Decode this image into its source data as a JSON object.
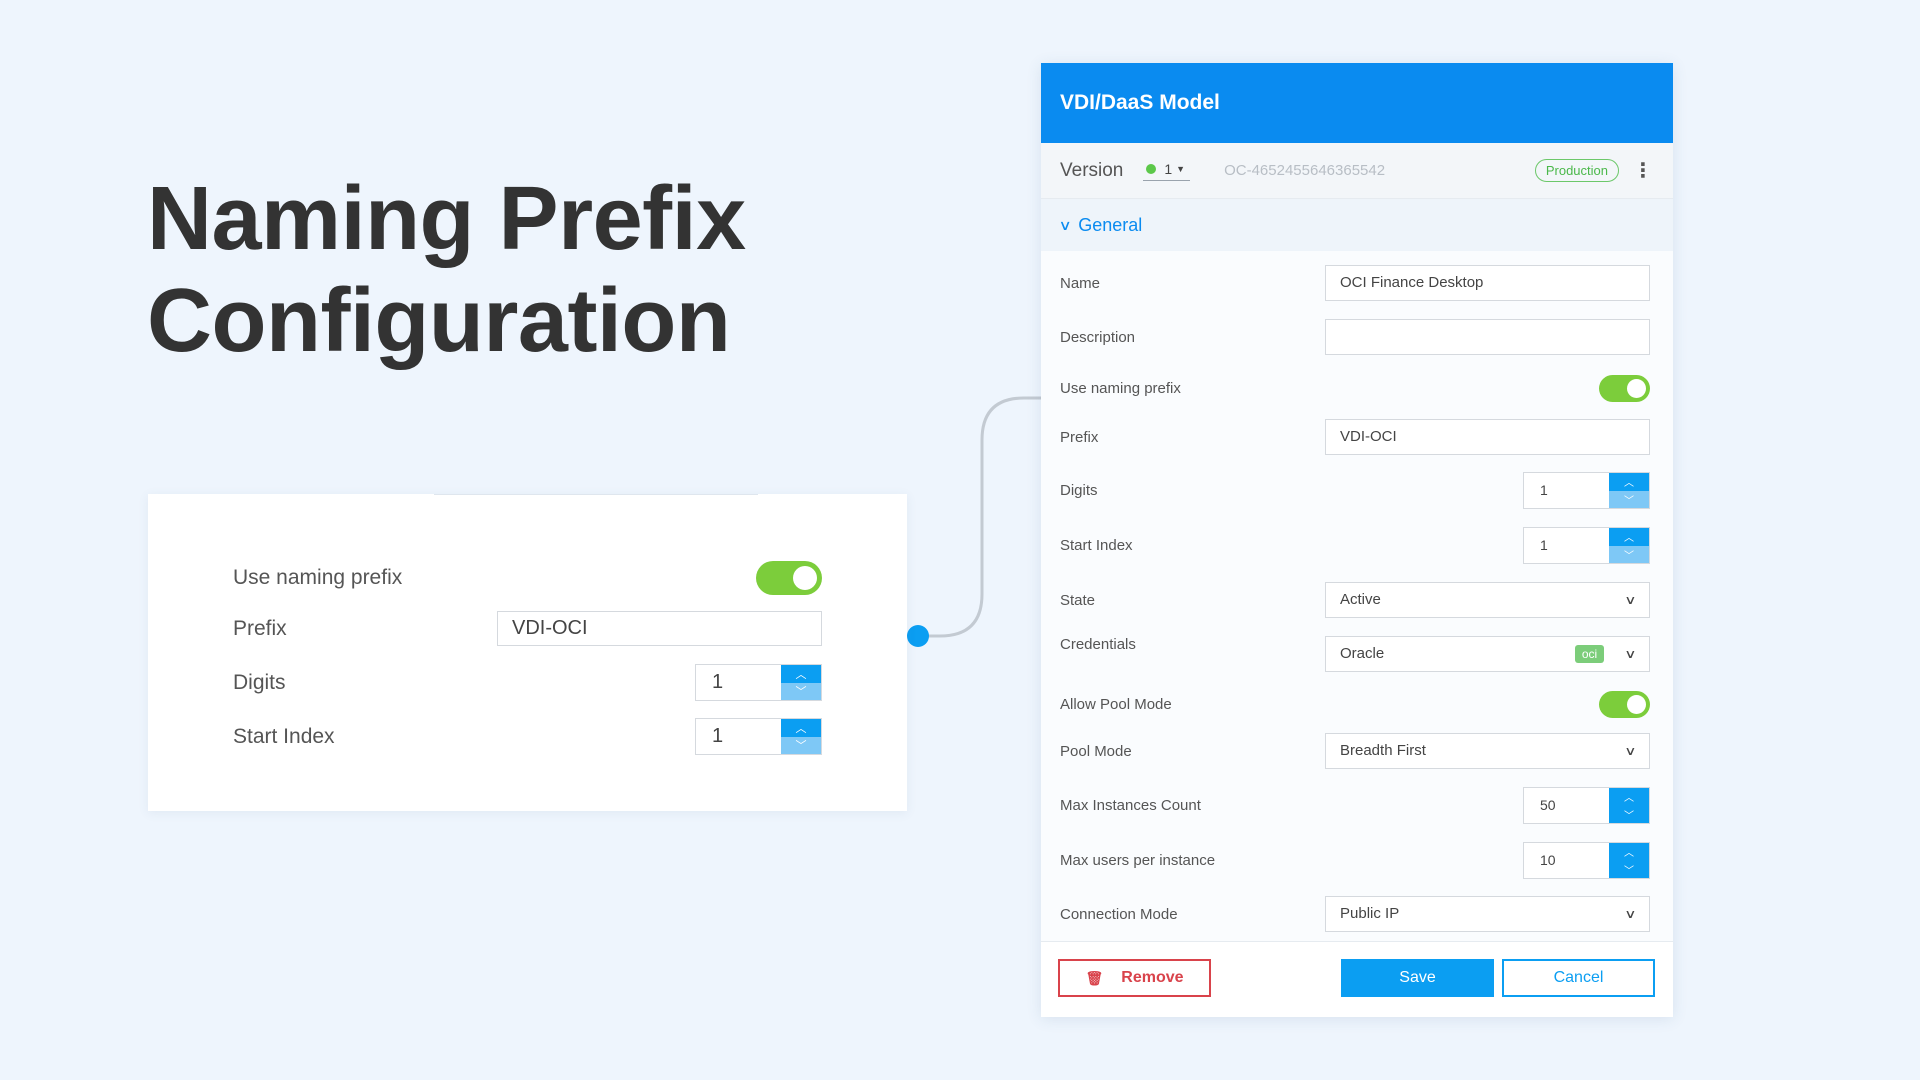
{
  "hero": {
    "line1": "Naming Prefix",
    "line2": "Configuration"
  },
  "zoom_card": {
    "use_naming_prefix_label": "Use naming prefix",
    "use_naming_prefix_on": true,
    "prefix_label": "Prefix",
    "prefix_value": "VDI-OCI",
    "digits_label": "Digits",
    "digits_value": "1",
    "start_index_label": "Start Index",
    "start_index_value": "1"
  },
  "dialog": {
    "title": "VDI/DaaS Model",
    "version": {
      "label": "Version",
      "selected": "1",
      "id": "OC-4652455646365542",
      "badge": "Production"
    },
    "section": "General",
    "fields": {
      "name_label": "Name",
      "name_value": "OCI Finance Desktop",
      "description_label": "Description",
      "description_value": "",
      "use_naming_prefix_label": "Use naming prefix",
      "prefix_label": "Prefix",
      "prefix_value": "VDI-OCI",
      "digits_label": "Digits",
      "digits_value": "1",
      "start_index_label": "Start Index",
      "start_index_value": "1",
      "state_label": "State",
      "state_value": "Active",
      "credentials_label": "Credentials",
      "credentials_value": "Oracle",
      "credentials_tag": "oci",
      "allow_pool_mode_label": "Allow Pool Mode",
      "pool_mode_label": "Pool Mode",
      "pool_mode_value": "Breadth First",
      "max_instances_label": "Max Instances Count",
      "max_instances_value": "50",
      "max_users_label": "Max users per instance",
      "max_users_value": "10",
      "connection_mode_label": "Connection Mode",
      "connection_mode_value": "Public IP"
    },
    "footer": {
      "remove_label": "Remove",
      "save_label": "Save",
      "cancel_label": "Cancel"
    }
  },
  "colors": {
    "accent": "#0a8bf0",
    "toggle_on": "#7ccd3b",
    "danger": "#d9434b",
    "badge_green": "#4bb84a"
  }
}
